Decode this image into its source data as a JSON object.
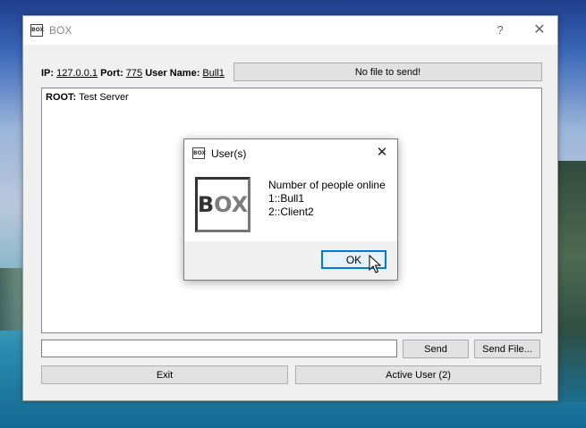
{
  "window": {
    "title": "BOX",
    "icon_text": "BOX",
    "help_label": "?",
    "close_label": "✕"
  },
  "connection": {
    "ip_label": "IP:",
    "ip_value": "127.0.0.1",
    "port_label": "Port:",
    "port_value": "775",
    "user_label": "User Name:",
    "user_value": "Bull1"
  },
  "file_button": {
    "label": "No file to send!"
  },
  "chat": {
    "root_label": "ROOT:",
    "root_text": "Test Server"
  },
  "message_input": {
    "value": ""
  },
  "buttons": {
    "send": "Send",
    "send_file": "Send File...",
    "exit": "Exit",
    "active_user": "Active User (2)"
  },
  "dialog": {
    "title": "User(s)",
    "icon_text": "BOX",
    "close_label": "✕",
    "logo_text_b": "B",
    "logo_text_rest": "OX",
    "message_line1": "Number of people online",
    "message_line2": "1::Bull1",
    "message_line3": "2::Client2",
    "ok_label": "OK"
  }
}
